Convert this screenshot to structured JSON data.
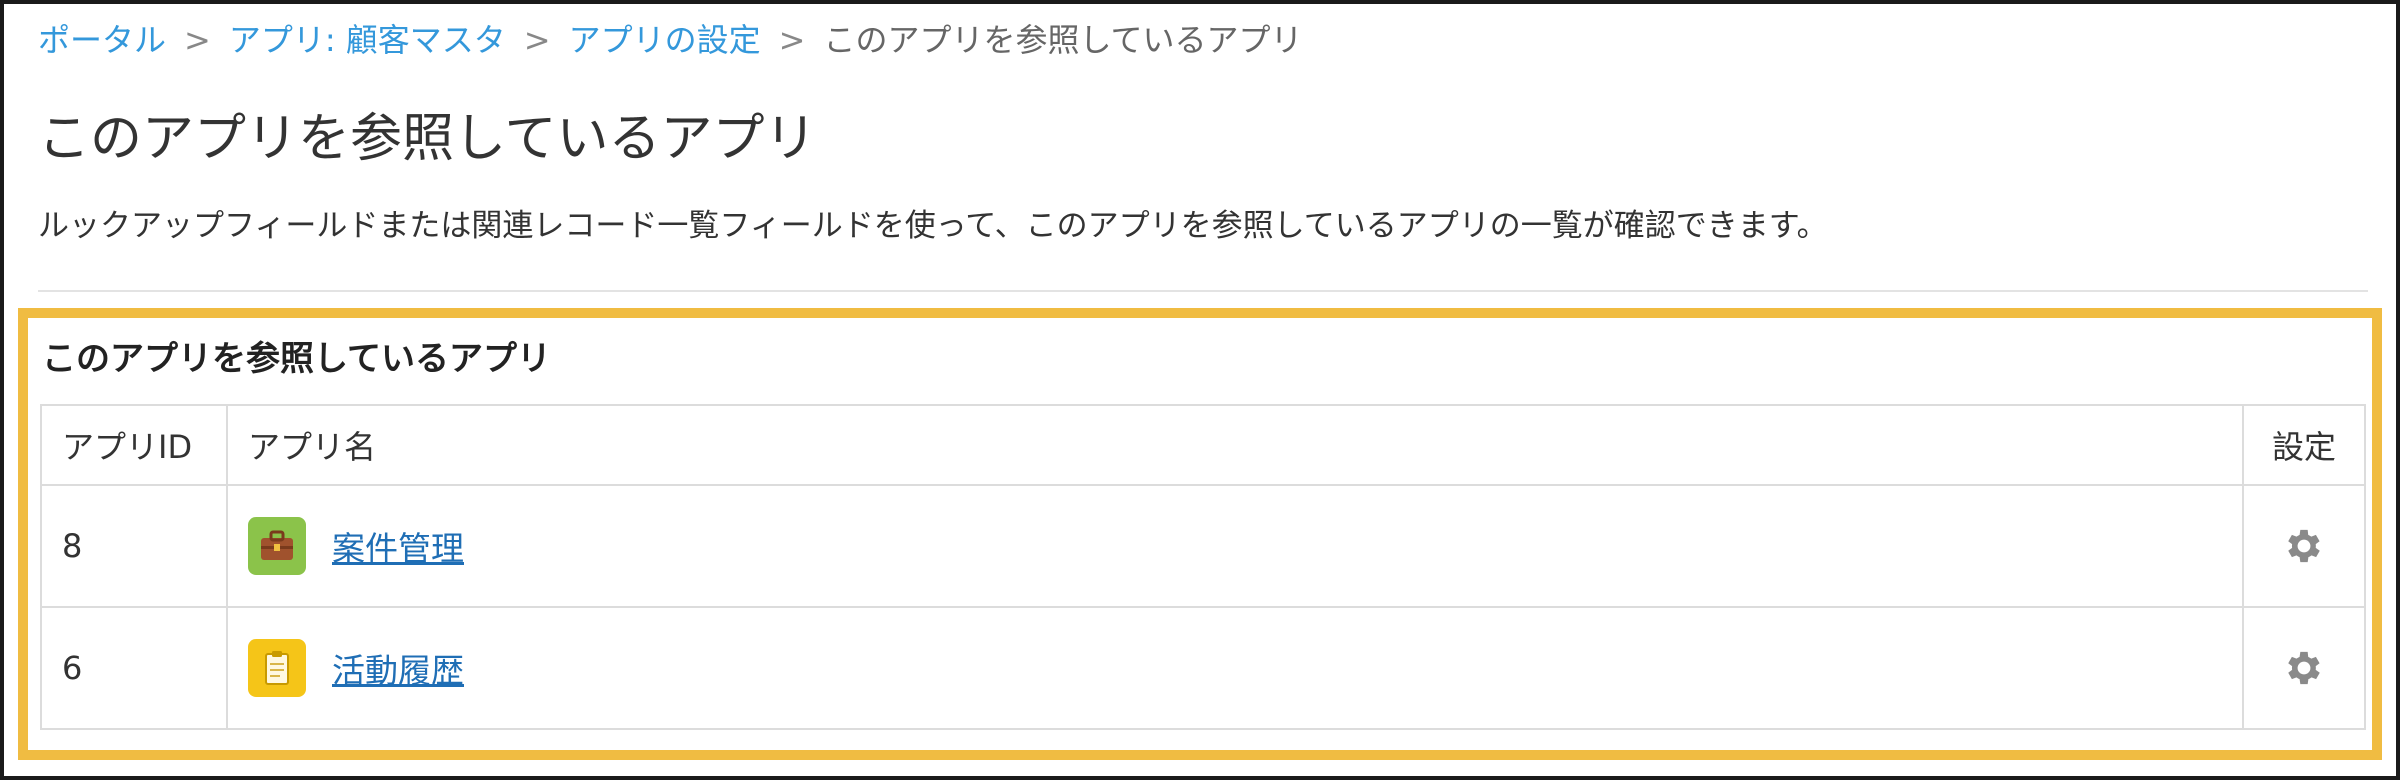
{
  "breadcrumb": {
    "items": [
      "ポータル",
      "アプリ: 顧客マスタ",
      "アプリの設定"
    ],
    "separator": ">",
    "current": "このアプリを参照しているアプリ"
  },
  "page": {
    "title": "このアプリを参照しているアプリ",
    "description": "ルックアップフィールドまたは関連レコード一覧フィールドを使って、このアプリを参照しているアプリの一覧が確認できます。"
  },
  "section": {
    "title": "このアプリを参照しているアプリ",
    "highlight_color": "#f0bc42"
  },
  "table": {
    "headers": {
      "id": "アプリID",
      "name": "アプリ名",
      "settings": "設定"
    },
    "rows": [
      {
        "id": "8",
        "name": "案件管理",
        "icon": "briefcase-icon",
        "icon_color": "#8bc34a",
        "settings_icon": "gear-icon"
      },
      {
        "id": "6",
        "name": "活動履歴",
        "icon": "clipboard-icon",
        "icon_color": "#f5c518",
        "settings_icon": "gear-icon"
      }
    ]
  },
  "colors": {
    "link": "#1f6eb5",
    "breadcrumb_link": "#3498db",
    "gear": "#8a8a8a"
  }
}
